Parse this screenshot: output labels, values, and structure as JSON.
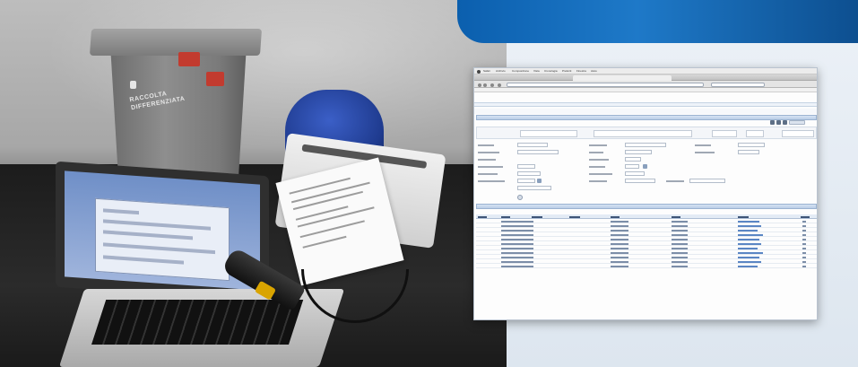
{
  "photo": {
    "bin_label_lines": [
      "RACCOLTA",
      "DIFFERENZIATA"
    ]
  },
  "app": {
    "menu": [
      "Safari",
      "Archivio",
      "Composizione",
      "Vista",
      "Cronologia",
      "Preferiti",
      "Finestra",
      "Aiuto"
    ],
    "tab_title": "",
    "url": "",
    "logo_text": "",
    "page_title": "",
    "section_top": "",
    "section_bottom": ""
  },
  "colors": {
    "banner": "#1e79c8",
    "right_bg": "#e6edf5",
    "section_bar": "#c8d8ec"
  }
}
